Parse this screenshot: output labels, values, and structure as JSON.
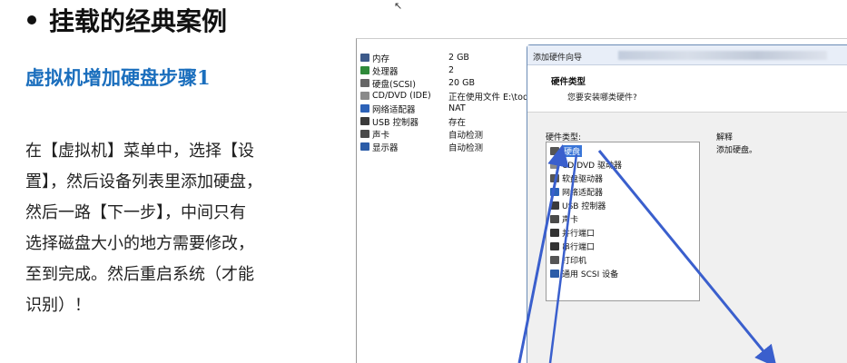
{
  "slide": {
    "title": "挂载的经典案例",
    "subtitle": "虚拟机增加硬盘步骤1",
    "body_lines": [
      "在【虚拟机】菜单中，选择【设",
      "置】，然后设备列表里添加硬盘，",
      "然后一路【下一步】，中间只有",
      "选择磁盘大小的地方需要修改，",
      "至到完成。然后重启系统（才能",
      "识别）！"
    ]
  },
  "vm_devices": [
    {
      "name": "内存",
      "value": "2 GB",
      "icon": "memory-icon",
      "color": "#3d5a8a"
    },
    {
      "name": "处理器",
      "value": "2",
      "icon": "cpu-icon",
      "color": "#2f8a3a"
    },
    {
      "name": "硬盘(SCSI)",
      "value": "20 GB",
      "icon": "harddisk-icon",
      "color": "#666666"
    },
    {
      "name": "CD/DVD (IDE)",
      "value": "正在使用文件 E:\\tod",
      "icon": "cdrom-icon",
      "color": "#8a8a8a"
    },
    {
      "name": "网络适配器",
      "value": "NAT",
      "icon": "network-icon",
      "color": "#2c62b8"
    },
    {
      "name": "USB 控制器",
      "value": "存在",
      "icon": "usb-icon",
      "color": "#3a3a3a"
    },
    {
      "name": "声卡",
      "value": "自动检测",
      "icon": "sound-icon",
      "color": "#4a4a4a"
    },
    {
      "name": "显示器",
      "value": "自动检测",
      "icon": "display-icon",
      "color": "#2b5ca8"
    }
  ],
  "wizard": {
    "window_title": "添加硬件向导",
    "header_title": "硬件类型",
    "header_subtitle": "您要安装哪类硬件?",
    "list_label": "硬件类型:",
    "explain_label": "解释",
    "explain_text": "添加硬盘。",
    "hardware_types": [
      {
        "label": "硬盘",
        "icon": "harddisk-icon",
        "color": "#555555",
        "selected": true
      },
      {
        "label": "CD/DVD 驱动器",
        "icon": "cdrom-icon",
        "color": "#8a8a8a",
        "selected": false
      },
      {
        "label": "软盘驱动器",
        "icon": "floppy-icon",
        "color": "#555555",
        "selected": false
      },
      {
        "label": "网络适配器",
        "icon": "network-icon",
        "color": "#2c62b8",
        "selected": false
      },
      {
        "label": "USB 控制器",
        "icon": "usb-icon",
        "color": "#3a3a3a",
        "selected": false
      },
      {
        "label": "声卡",
        "icon": "sound-icon",
        "color": "#4a4a4a",
        "selected": false
      },
      {
        "label": "并行端口",
        "icon": "parallel-port-icon",
        "color": "#333333",
        "selected": false
      },
      {
        "label": "串行端口",
        "icon": "serial-port-icon",
        "color": "#333333",
        "selected": false
      },
      {
        "label": "打印机",
        "icon": "printer-icon",
        "color": "#555555",
        "selected": false
      },
      {
        "label": "通用 SCSI 设备",
        "icon": "scsi-icon",
        "color": "#2b5ca8",
        "selected": false
      }
    ]
  },
  "colors": {
    "subtitle": "#1a6ebd",
    "arrow": "#3a5fcd",
    "selection": "#3a76d8"
  }
}
